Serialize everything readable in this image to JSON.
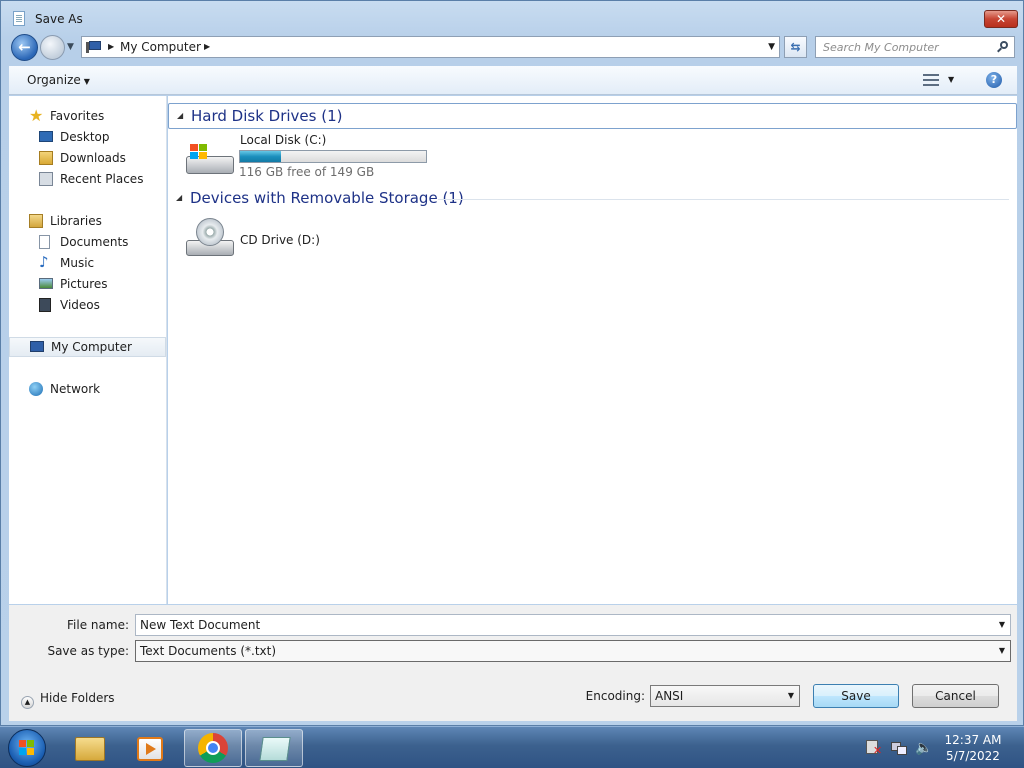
{
  "window": {
    "title": "Save As",
    "close_label": "✕"
  },
  "address": {
    "path": "My Computer",
    "search_placeholder": "Search My Computer"
  },
  "toolbar": {
    "organize_label": "Organize",
    "help_label": "?"
  },
  "navigation": {
    "favorites": {
      "label": "Favorites",
      "items": [
        {
          "label": "Desktop",
          "icon": "desktop-icon"
        },
        {
          "label": "Downloads",
          "icon": "downloads-folder-icon"
        },
        {
          "label": "Recent Places",
          "icon": "recent-places-icon"
        }
      ]
    },
    "libraries": {
      "label": "Libraries",
      "items": [
        {
          "label": "Documents",
          "icon": "documents-icon"
        },
        {
          "label": "Music",
          "icon": "music-icon"
        },
        {
          "label": "Pictures",
          "icon": "pictures-icon"
        },
        {
          "label": "Videos",
          "icon": "videos-icon"
        }
      ]
    },
    "computer": {
      "label": "My Computer",
      "selected": true
    },
    "network": {
      "label": "Network"
    }
  },
  "content": {
    "groups": [
      {
        "title": "Hard Disk Drives (1)",
        "items": [
          {
            "name": "Local Disk (C:)",
            "free_text": "116 GB free of 149 GB",
            "used_fraction": 0.22
          }
        ]
      },
      {
        "title": "Devices with Removable Storage (1)",
        "items": [
          {
            "name": "CD Drive (D:)"
          }
        ]
      }
    ]
  },
  "form": {
    "file_name_label": "File name:",
    "file_name_value": "New Text Document",
    "save_type_label": "Save as type:",
    "save_type_value": "Text Documents (*.txt)",
    "encoding_label": "Encoding:",
    "encoding_value": "ANSI",
    "hide_folders_label": "Hide Folders",
    "save_label": "Save",
    "cancel_label": "Cancel"
  },
  "taskbar": {
    "time": "12:37 AM",
    "date": "5/7/2022"
  },
  "colors": {
    "accent": "#1e3287",
    "drive_fill": "#1c8fbd",
    "close": "#c74533"
  }
}
